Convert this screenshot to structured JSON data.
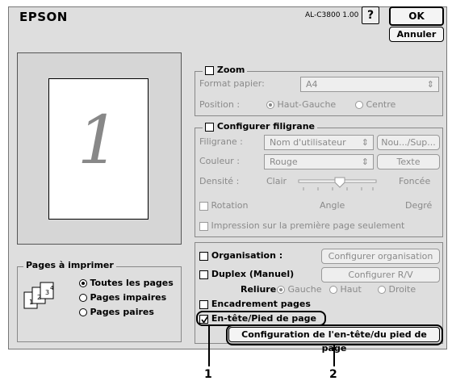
{
  "header": {
    "brand": "EPSON",
    "model": "AL-C3800 1.00",
    "help_label": "?",
    "ok_label": "OK",
    "cancel_label": "Annuler"
  },
  "preview": {
    "page_number": "1"
  },
  "zoom": {
    "title": "Zoom",
    "format_label": "Format papier:",
    "format_value": "A4",
    "position_label": "Position :",
    "pos_option_1": "Haut-Gauche",
    "pos_option_2": "Centre"
  },
  "watermark": {
    "title": "Configurer filigrane",
    "filigrane_label": "Filigrane :",
    "filigrane_value": "Nom d'utilisateur",
    "new_button": "Nou.../Sup...",
    "color_label": "Couleur :",
    "color_value": "Rouge",
    "text_button": "Texte",
    "density_label": "Densité :",
    "density_min": "Clair",
    "density_max": "Foncée",
    "rotation_label": "Rotation",
    "angle_label": "Angle",
    "degree_label": "Degré",
    "first_page_label": "Impression sur la première page seulement"
  },
  "pages": {
    "title": "Pages à imprimer",
    "option_all": "Toutes les pages",
    "option_odd": "Pages impaires",
    "option_even": "Pages paires"
  },
  "layout": {
    "organisation_label": "Organisation :",
    "organisation_button": "Configurer organisation",
    "duplex_label": "Duplex (Manuel)",
    "duplex_button": "Configurer R/V",
    "binding_label": "Reliure",
    "binding_left": "Gauche",
    "binding_top": "Haut",
    "binding_right": "Droite",
    "frame_label": "Encadrement pages",
    "header_footer_label": "En-tête/Pied de page",
    "header_footer_button": "Configuration de l'en-tête/du pied de page"
  },
  "callouts": {
    "one": "1",
    "two": "2"
  },
  "icons": {
    "chevron": "⇕"
  }
}
